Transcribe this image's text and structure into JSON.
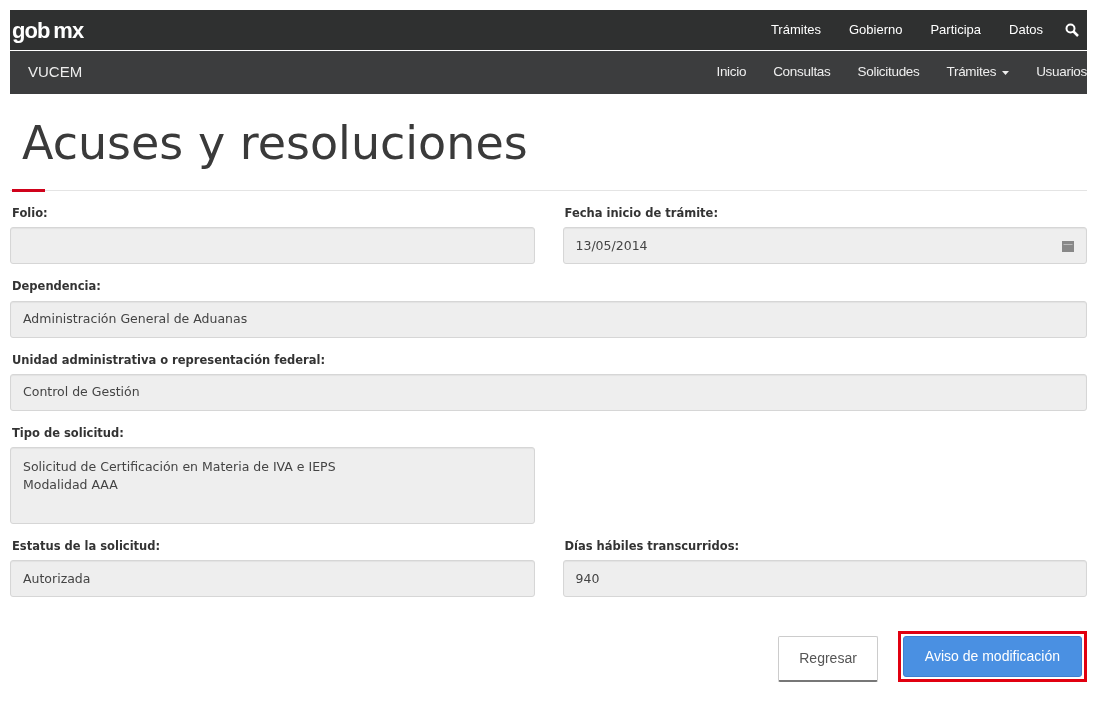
{
  "top_bar": {
    "logo": "gob",
    "logo_suffix": "mx",
    "links": [
      "Trámites",
      "Gobierno",
      "Participa",
      "Datos"
    ]
  },
  "app_bar": {
    "brand": "VUCEM",
    "items": [
      {
        "label": "Inicio",
        "kind": "link"
      },
      {
        "label": "Consultas",
        "kind": "link"
      },
      {
        "label": "Solicitudes",
        "kind": "link"
      },
      {
        "label": "Trámites",
        "kind": "dropdown"
      },
      {
        "label": "Usuarios",
        "kind": "link"
      }
    ]
  },
  "page_title": "Acuses y resoluciones",
  "form_rows": [
    [
      {
        "label": "Folio:",
        "kind": "text",
        "wide": false
      },
      {
        "label": "Fecha inicio de trámite:",
        "value": "13/05/2014",
        "kind": "date",
        "wide": false
      }
    ],
    [
      {
        "label": "Dependencia:",
        "value": "Administración General de Aduanas",
        "kind": "text",
        "wide": true
      }
    ],
    [
      {
        "label": "Unidad administrativa o representación federal:",
        "value": "Control de Gestión",
        "kind": "text",
        "wide": true
      }
    ],
    [
      {
        "label": "Tipo de solicitud:",
        "value": "Solicitud de Certificación en Materia de IVA e IEPS\nModalidad AAA",
        "kind": "textarea",
        "wide": false
      }
    ],
    [
      {
        "label": "Estatus de la solicitud:",
        "value": "Autorizada",
        "kind": "text",
        "wide": false
      },
      {
        "label": "Días hábiles transcurridos:",
        "value": "940",
        "kind": "text",
        "wide": false
      }
    ]
  ],
  "buttons": [
    {
      "label": "Regresar",
      "kind": "default",
      "highlighted": false
    },
    {
      "label": "Aviso de modificación",
      "kind": "primary",
      "highlighted": true
    }
  ]
}
